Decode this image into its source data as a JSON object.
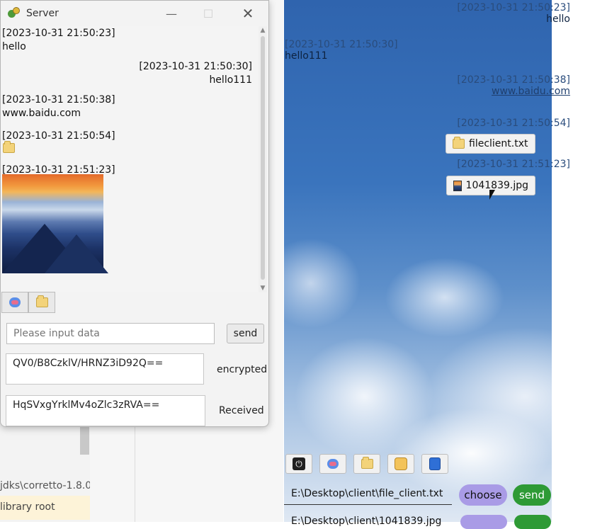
{
  "ide": {
    "line1": "jdks\\corretto-1.8.0",
    "line2": "library root"
  },
  "client": {
    "messages": [
      {
        "side": "right",
        "time": "[2023-10-31 21:50:23]",
        "text": "hello"
      },
      {
        "side": "left",
        "time": "[2023-10-31 21:50:30]",
        "text": "hello111"
      },
      {
        "side": "right",
        "time": "[2023-10-31 21:50:38]",
        "text": "www.baidu.com"
      },
      {
        "side": "right",
        "time": "[2023-10-31 21:50:54]",
        "file": "fileclient.txt"
      },
      {
        "side": "right",
        "time": "[2023-10-31 21:51:23]",
        "file": "1041839.jpg"
      }
    ],
    "toolbar_icons": [
      "power-icon",
      "chat-icon",
      "folder-icon",
      "cat-icon",
      "calculator-icon"
    ],
    "path_value": "E:\\Desktop\\client\\file_client.txt",
    "path_value2": "E:\\Desktop\\client\\1041839.jpg",
    "choose_label": "choose",
    "send_label": "send"
  },
  "server": {
    "title": "Server",
    "messages": [
      {
        "side": "left",
        "time": "[2023-10-31 21:50:23]",
        "text": "hello"
      },
      {
        "side": "right",
        "time": "[2023-10-31 21:50:30]",
        "text": "hello111"
      },
      {
        "side": "left",
        "time": "[2023-10-31 21:50:38]",
        "text": "www.baidu.com"
      },
      {
        "side": "left",
        "time": "[2023-10-31 21:50:54]"
      },
      {
        "side": "left",
        "time": "[2023-10-31 21:51:23]"
      }
    ],
    "toolbar_icons": [
      "chat-icon",
      "folder-icon"
    ],
    "input_placeholder": "Please input data",
    "send_label": "send",
    "encrypted_value": "QV0/B8CzklV/HRNZ3iD92Q==",
    "encrypted_label": "encrypted",
    "received_value": "HqSVxgYrklMv4oZlc3zRVA==",
    "received_label": "Received"
  },
  "colors": {
    "choose_pill": "#a99be6",
    "send_pill": "#2e9a35"
  }
}
